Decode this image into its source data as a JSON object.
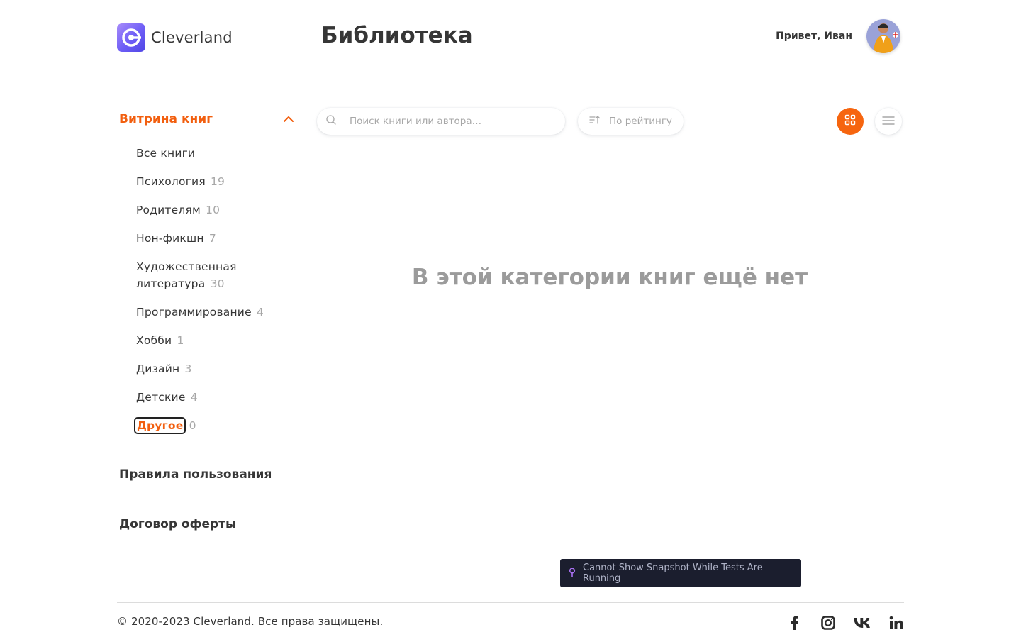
{
  "header": {
    "logo_text": "Cleverland",
    "page_title": "Библиотека",
    "greeting": "Привет, Иван"
  },
  "sidebar": {
    "showcase_title": "Витрина книг",
    "categories": [
      {
        "label": "Все книги",
        "count": ""
      },
      {
        "label": "Психология",
        "count": "19"
      },
      {
        "label": "Родителям",
        "count": "10"
      },
      {
        "label": "Нон-фикшн",
        "count": "7"
      },
      {
        "label": "Художественная литература",
        "count": "30"
      },
      {
        "label": "Программирование",
        "count": "4"
      },
      {
        "label": "Хобби",
        "count": "1"
      },
      {
        "label": "Дизайн",
        "count": "3"
      },
      {
        "label": "Детские",
        "count": "4"
      },
      {
        "label": "Другое",
        "count": "0"
      }
    ],
    "active_category": "Другое",
    "rules_link": "Правила пользования",
    "offer_link": "Договор оферты"
  },
  "toolbar": {
    "search_placeholder": "Поиск книги или автора…",
    "sort_label": "По рейтингу",
    "active_view": "grid"
  },
  "main": {
    "empty_message": "В этой категории книг ещё нет"
  },
  "toast": {
    "text": "Cannot Show Snapshot While Tests Are Running"
  },
  "footer": {
    "copyright": "© 2020-2023 Cleverland. Все права защищены.",
    "socials": [
      "facebook-icon",
      "instagram-icon",
      "vk-icon",
      "linkedin-icon"
    ]
  },
  "colors": {
    "accent": "#f25f0f",
    "text": "#363636",
    "muted": "#a7a7a7",
    "toast_bg": "#1b1e2e"
  }
}
